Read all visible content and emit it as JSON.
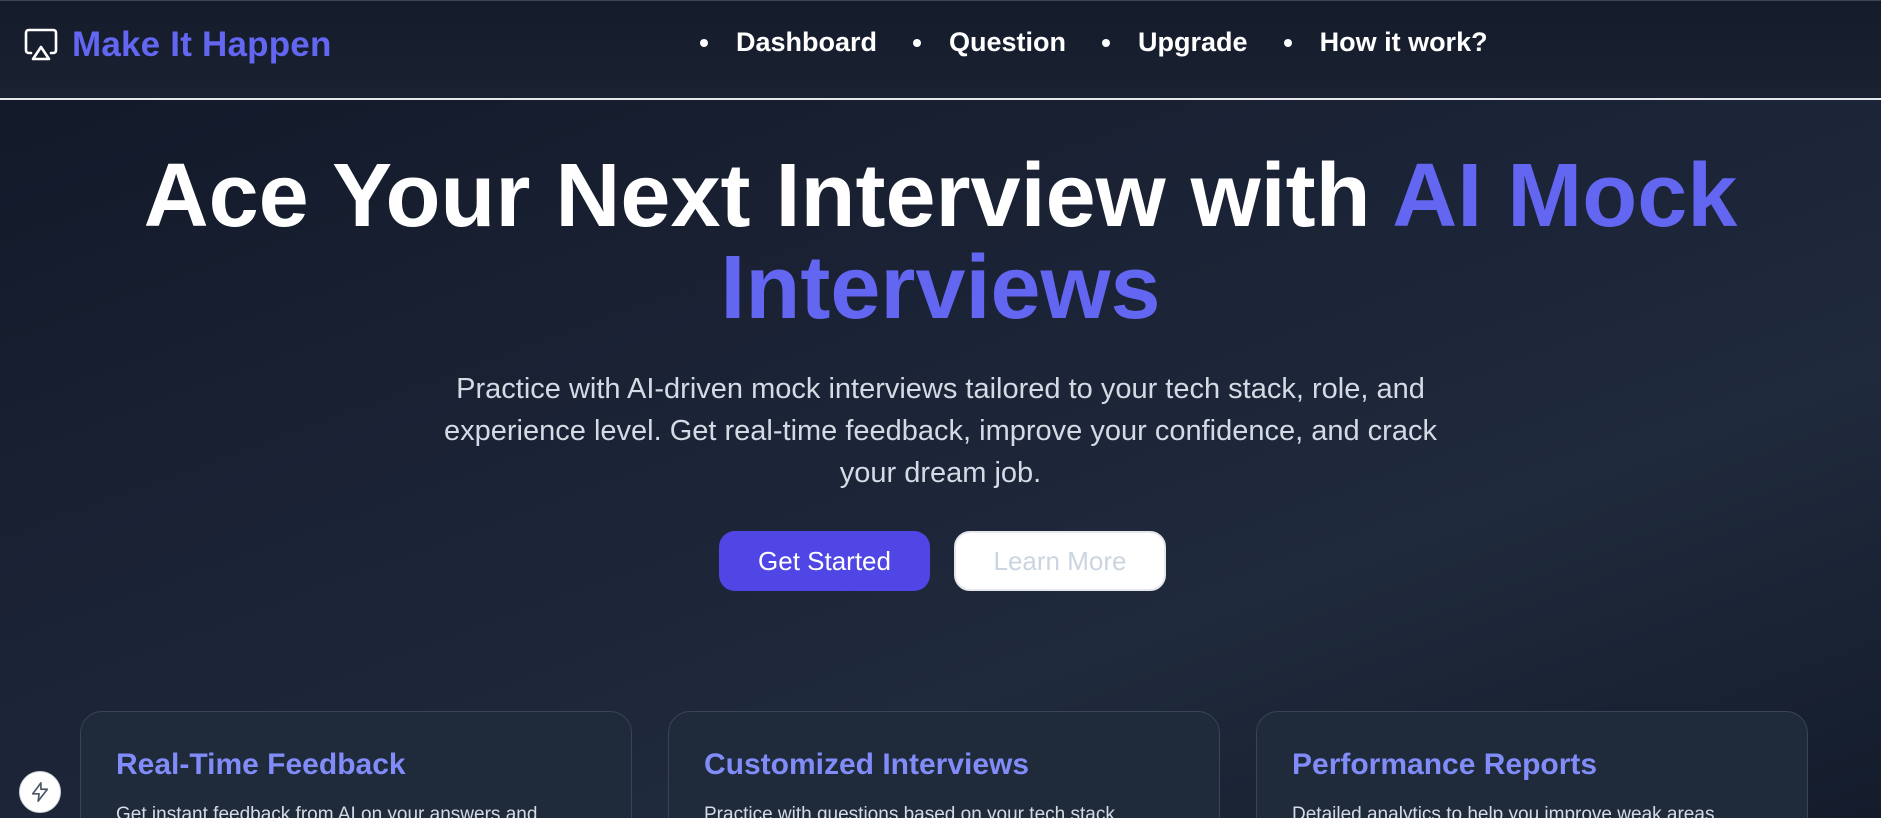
{
  "header": {
    "brand_icon": "cast-icon",
    "brand_name": "Make It Happen",
    "nav": [
      {
        "label": "Dashboard"
      },
      {
        "label": "Question"
      },
      {
        "label": "Upgrade"
      },
      {
        "label": "How it work?"
      }
    ]
  },
  "hero": {
    "title_main": "Ace Your Next Interview with ",
    "title_accent": "AI Mock Interviews",
    "subtitle": "Practice with AI-driven mock interviews tailored to your tech stack, role, and experience level. Get real-time feedback, improve your confidence, and crack your dream job.",
    "primary_cta": "Get Started",
    "secondary_cta": "Learn More"
  },
  "features": [
    {
      "title": "Real-Time Feedback",
      "description": "Get instant feedback from AI on your answers and"
    },
    {
      "title": "Customized Interviews",
      "description": "Practice with questions based on your tech stack"
    },
    {
      "title": "Performance Reports",
      "description": "Detailed analytics to help you improve weak areas"
    }
  ],
  "floating_button": {
    "icon": "lightning-bolt-icon"
  },
  "colors": {
    "accent": "#6366f1",
    "primary_button": "#4f46e5",
    "card_title": "#818cf8",
    "background": "#1b2336"
  }
}
